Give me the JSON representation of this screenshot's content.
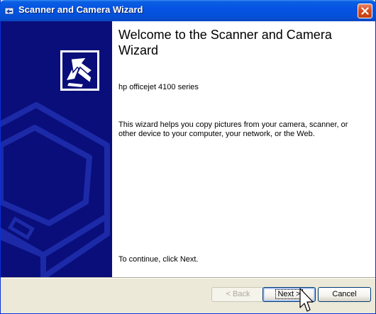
{
  "window": {
    "title": "Scanner and Camera Wizard"
  },
  "main": {
    "heading": "Welcome to the Scanner and Camera Wizard",
    "device_name": "hp officejet 4100 series",
    "description": "This wizard helps you copy pictures from your camera, scanner, or other device to your computer, your network, or the Web.",
    "continue_text": "To continue, click Next."
  },
  "buttons": {
    "back": "< Back",
    "next": "Next >",
    "cancel": "Cancel"
  },
  "colors": {
    "titlebar": "#0553e3",
    "sidebar": "#0a0e7a",
    "dialog_face": "#ece9d8"
  },
  "icons": [
    "wizard-app-icon",
    "close-icon",
    "wizard-logo-icon",
    "scanner-graphic",
    "mouse-cursor-icon"
  ]
}
